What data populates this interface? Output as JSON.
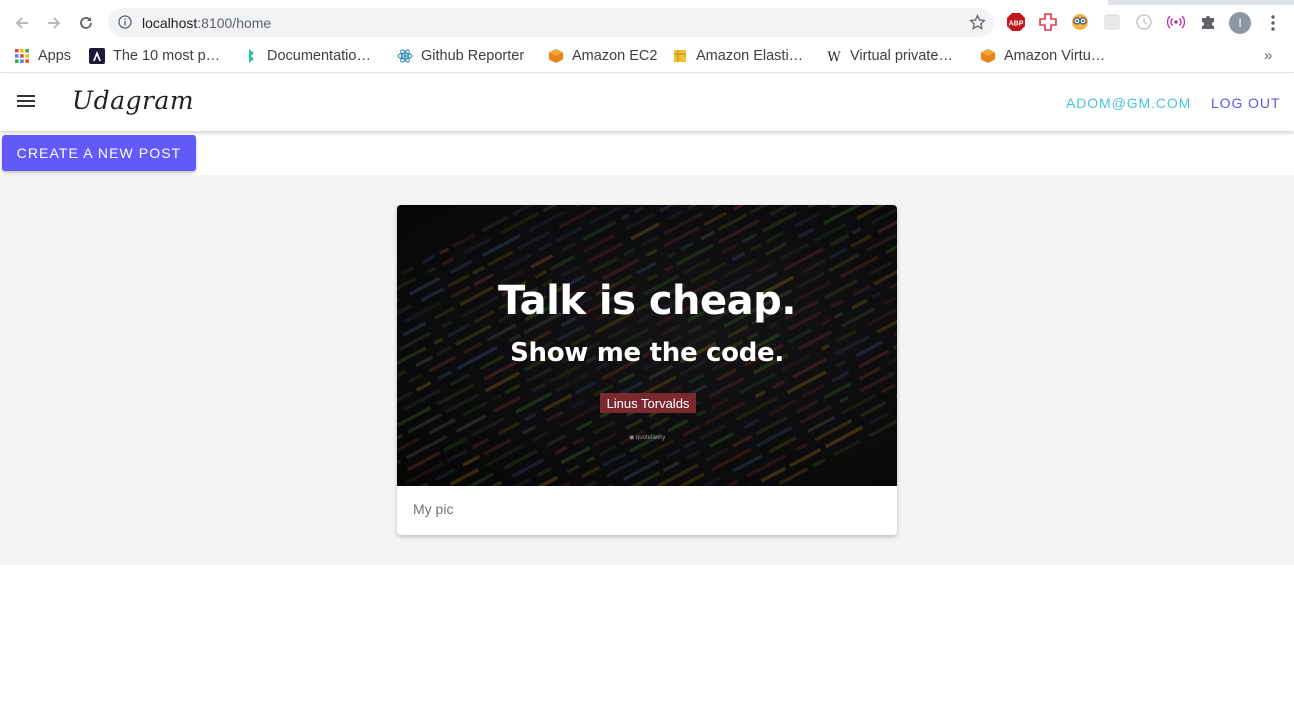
{
  "browser": {
    "url_host": "localhost",
    "url_rest": ":8100/home",
    "profile_initial": "I",
    "bookmarks": [
      {
        "label": "Apps",
        "icon": "apps-grid-icon"
      },
      {
        "label": "The 10 most p…",
        "icon": "angular-icon"
      },
      {
        "label": "Documentatio…",
        "icon": "leaf-icon"
      },
      {
        "label": "Github Reporter",
        "icon": "react-icon"
      },
      {
        "label": "Amazon EC2",
        "icon": "aws-cube-icon"
      },
      {
        "label": "Amazon Elasti…",
        "icon": "aws-box-icon"
      },
      {
        "label": "Virtual private…",
        "icon": "wikipedia-icon"
      },
      {
        "label": "Amazon Virtu…",
        "icon": "aws-cube-icon"
      }
    ],
    "extensions": [
      "adblock-icon",
      "first-aid-icon",
      "owl-icon",
      "blank-extension-icon",
      "timer-icon",
      "cast-icon",
      "puzzle-icon"
    ],
    "extension_labels": {
      "adblock": "ABP"
    },
    "overflow_label": "»"
  },
  "header": {
    "brand": "Udagram",
    "user_email": "ADOM@GM.COM",
    "logout_label": "LOG OUT"
  },
  "actions": {
    "new_post_label": "CREATE A NEW POST"
  },
  "feed": {
    "posts": [
      {
        "image": {
          "line1": "Talk is cheap.",
          "line2": "Show me the code.",
          "author": "Linus Torvalds",
          "watermark": "◉ quotefancy"
        },
        "caption": "My pic"
      }
    ]
  },
  "colors": {
    "primary": "#6159f8",
    "email": "#49c2dc",
    "logout": "#5a56f5",
    "content_bg": "#f4f4f4"
  }
}
